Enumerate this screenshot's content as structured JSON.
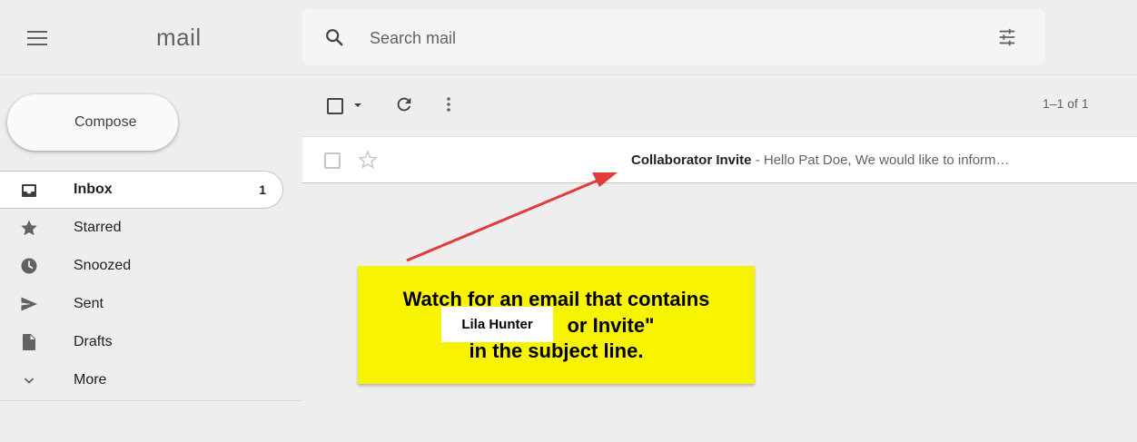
{
  "header": {
    "logo_text": "mail",
    "search_placeholder": "Search mail"
  },
  "sidebar": {
    "compose_label": "Compose",
    "items": [
      {
        "label": "Inbox",
        "icon": "inbox-icon",
        "count": "1",
        "active": true
      },
      {
        "label": "Starred",
        "icon": "star-icon"
      },
      {
        "label": "Snoozed",
        "icon": "clock-icon"
      },
      {
        "label": "Sent",
        "icon": "send-icon"
      },
      {
        "label": "Drafts",
        "icon": "draft-icon"
      },
      {
        "label": "More",
        "icon": "chevron-down-icon"
      }
    ]
  },
  "toolbar": {
    "pagination": "1–1 of 1"
  },
  "email": {
    "subject": "Collaborator Invite",
    "separator": " - ",
    "snippet": "Hello Pat Doe, We would like to inform…"
  },
  "annotation": {
    "lines": [
      "Watch for an email that contains",
      "or Invite\"",
      "in the subject line."
    ],
    "name_tag": "Lila Hunter",
    "arrow_color": "#e03c3c",
    "callout_color": "#f8f300"
  }
}
